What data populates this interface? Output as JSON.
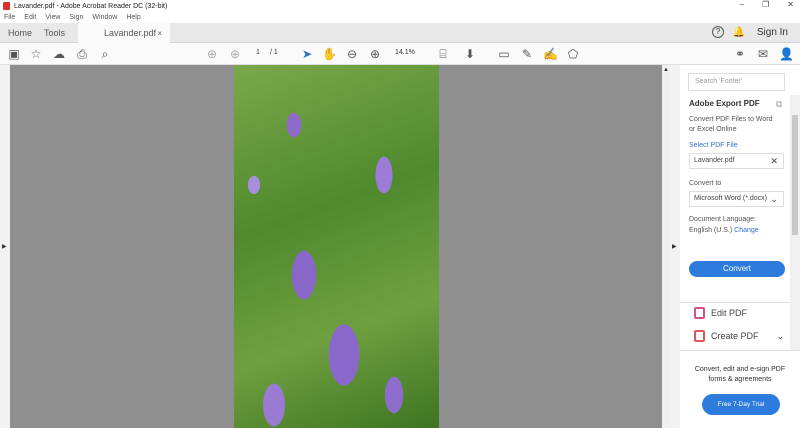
{
  "window": {
    "title": "Lavander.pdf - Adobe Acrobat Reader DC (32-bit)",
    "controls": [
      "–",
      "❐",
      "✕"
    ]
  },
  "menu": [
    "File",
    "Edit",
    "View",
    "Sign",
    "Window",
    "Help"
  ],
  "tabs": {
    "home": "Home",
    "tools": "Tools",
    "document": "Lavander.pdf",
    "close": "×"
  },
  "header": {
    "help": "?",
    "signin": "Sign In"
  },
  "toolbar": {
    "page_current": "1",
    "page_total": "/ 1",
    "zoom": "14.1%"
  },
  "panel": {
    "search_placeholder": "Search 'Footer'",
    "title": "Adobe Export PDF",
    "description": "Convert PDF Files to Word or Excel Online",
    "select_label": "Select PDF File",
    "file": "Lavander.pdf",
    "convert_to_label": "Convert to",
    "convert_to_value": "Microsoft Word (*.docx)",
    "language_label": "Document Language:",
    "language_value": "English (U.S.)",
    "change": "Change",
    "convert_button": "Convert",
    "tools": [
      "Edit PDF",
      "Create PDF"
    ],
    "promo_text": "Convert, edit and e-sign PDF forms & agreements",
    "trial_button": "Free 7-Day Trial"
  }
}
